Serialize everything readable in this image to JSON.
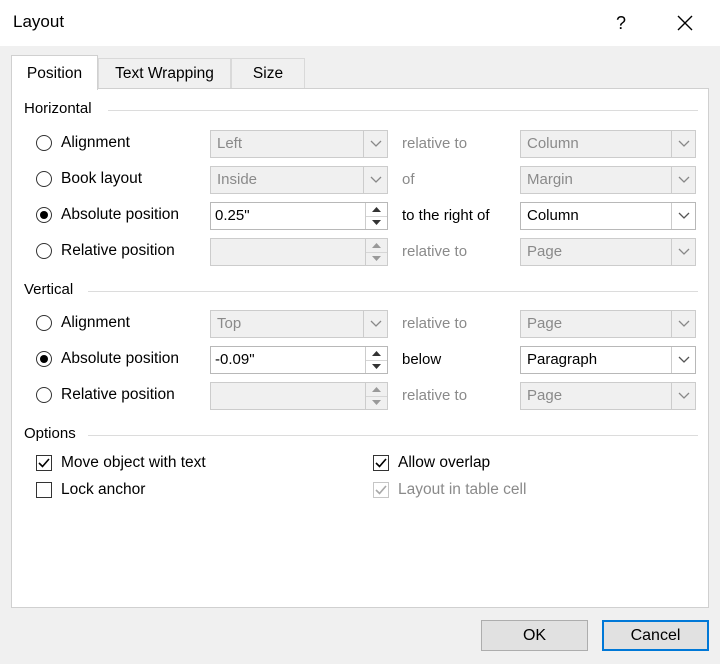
{
  "window": {
    "title": "Layout",
    "help": "?"
  },
  "tabs": [
    {
      "label": "Position",
      "active": true
    },
    {
      "label": "Text Wrapping",
      "active": false
    },
    {
      "label": "Size",
      "active": false
    }
  ],
  "horizontal": {
    "title": "Horizontal",
    "rows": [
      {
        "label": "Alignment",
        "selected": false,
        "control": "Left",
        "relation": "relative to",
        "target": "Column",
        "enabled": false
      },
      {
        "label": "Book layout",
        "selected": false,
        "control": "Inside",
        "relation": "of",
        "target": "Margin",
        "enabled": false
      },
      {
        "label": "Absolute position",
        "selected": true,
        "control": "0.25\"",
        "relation": "to the right of",
        "target": "Column",
        "enabled": true
      },
      {
        "label": "Relative position",
        "selected": false,
        "control": "",
        "relation": "relative to",
        "target": "Page",
        "enabled": false
      }
    ]
  },
  "vertical": {
    "title": "Vertical",
    "rows": [
      {
        "label": "Alignment",
        "selected": false,
        "control": "Top",
        "relation": "relative to",
        "target": "Page",
        "enabled": false
      },
      {
        "label": "Absolute position",
        "selected": true,
        "control": "-0.09\"",
        "relation": "below",
        "target": "Paragraph",
        "enabled": true
      },
      {
        "label": "Relative position",
        "selected": false,
        "control": "",
        "relation": "relative to",
        "target": "Page",
        "enabled": false
      }
    ]
  },
  "options": {
    "title": "Options",
    "move_with_text": {
      "label": "Move object with text",
      "checked": true
    },
    "lock_anchor": {
      "label": "Lock anchor",
      "checked": false
    },
    "allow_overlap": {
      "label": "Allow overlap",
      "checked": true
    },
    "layout_in_table_cell": {
      "label": "Layout in table cell",
      "checked": true,
      "enabled": false
    }
  },
  "buttons": {
    "ok": "OK",
    "cancel": "Cancel"
  },
  "colors": {
    "focus_border": "#0078d7",
    "disabled_text": "#8a8a8a"
  }
}
